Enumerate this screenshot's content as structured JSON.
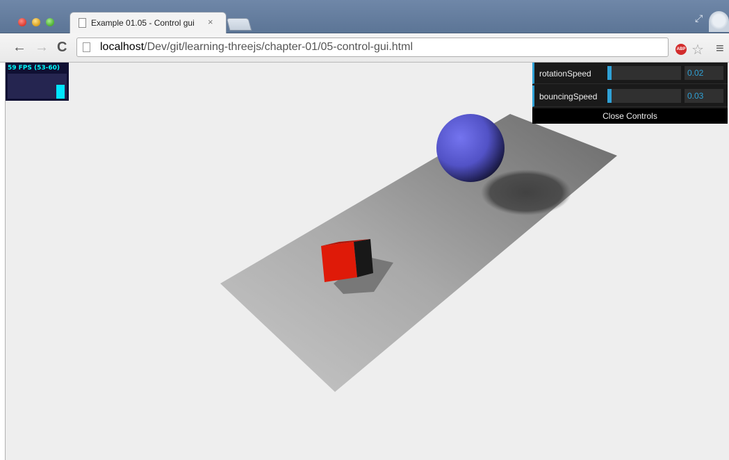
{
  "window": {
    "tab_title": "Example 01.05 - Control gui",
    "tab_close": "×"
  },
  "toolbar": {
    "back_glyph": "←",
    "forward_glyph": "→",
    "reload_glyph": "C",
    "url_host": "localhost",
    "url_path": "/Dev/git/learning-threejs/chapter-01/05-control-gui.html",
    "abp_label": "ABP",
    "star_glyph": "☆",
    "menu_glyph": "≡"
  },
  "stats": {
    "fps_text": "59 FPS (53-60)",
    "fps_level": 0.55
  },
  "gui": {
    "controls": [
      {
        "label": "rotationSpeed",
        "value": "0.02",
        "fraction": 0.04
      },
      {
        "label": "bouncingSpeed",
        "value": "0.03",
        "fraction": 0.05
      }
    ],
    "close_label": "Close Controls",
    "accent": "#2fa1d6"
  },
  "scene": {
    "background": "#eeeeee",
    "plane_color": "#b0b0b0",
    "cube_color": "#e01a0a",
    "sphere_color": "#6565e0"
  }
}
